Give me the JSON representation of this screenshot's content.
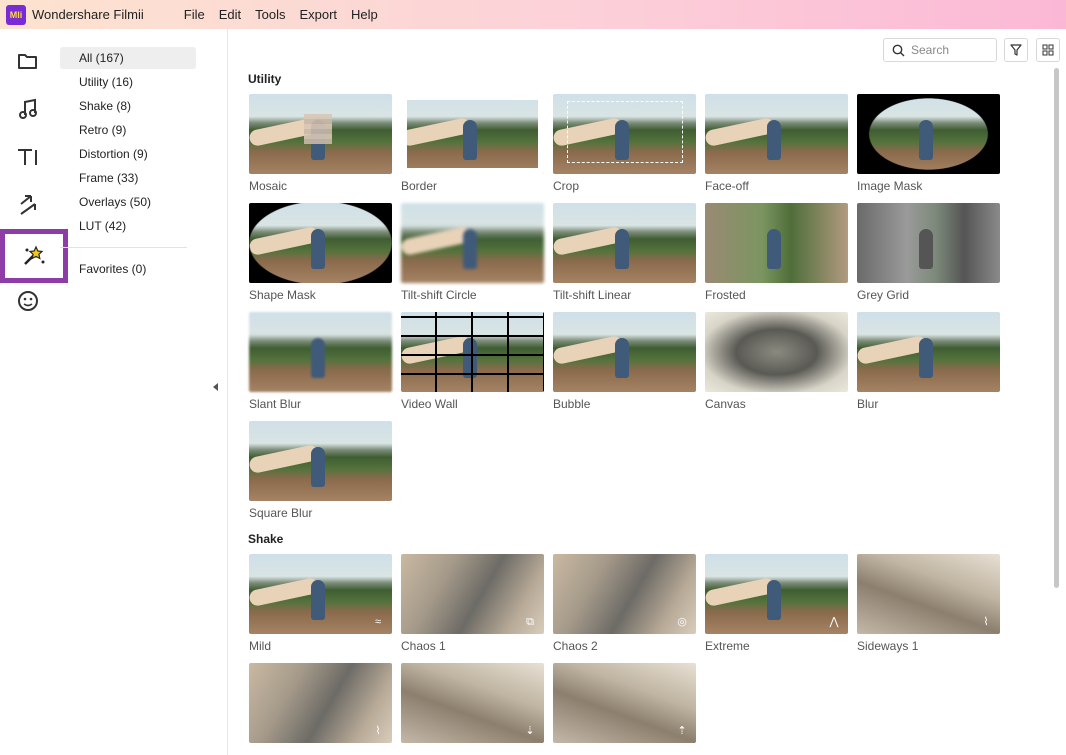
{
  "app": {
    "name": "Wondershare Filmii",
    "logo_text": "Mli"
  },
  "menu": [
    "File",
    "Edit",
    "Tools",
    "Export",
    "Help"
  ],
  "rail": [
    "folder-icon",
    "music-icon",
    "text-icon",
    "transition-icon",
    "effects-icon",
    "sticker-icon"
  ],
  "categories": [
    {
      "label": "All (167)",
      "selected": true
    },
    {
      "label": "Utility (16)"
    },
    {
      "label": "Shake (8)"
    },
    {
      "label": "Retro (9)"
    },
    {
      "label": "Distortion (9)"
    },
    {
      "label": "Frame (33)"
    },
    {
      "label": "Overlays (50)"
    },
    {
      "label": "LUT (42)"
    }
  ],
  "favorites": "Favorites (0)",
  "search": {
    "placeholder": "Search"
  },
  "sections": [
    {
      "title": "Utility",
      "items": [
        "Mosaic",
        "Border",
        "Crop",
        "Face-off",
        "Image Mask",
        "Shape Mask",
        "Tilt-shift Circle",
        "Tilt-shift Linear",
        "Frosted",
        "Grey Grid",
        "Slant Blur",
        "Video Wall",
        "Bubble",
        "Canvas",
        "Blur",
        "Square Blur"
      ]
    },
    {
      "title": "Shake",
      "items": [
        "Mild",
        "Chaos 1",
        "Chaos 2",
        "Extreme",
        "Sideways 1"
      ]
    }
  ],
  "colors": {
    "accent": "#8e3ca8",
    "title_gradient_start": "#fde3cf",
    "title_gradient_end": "#fbb8d6"
  }
}
